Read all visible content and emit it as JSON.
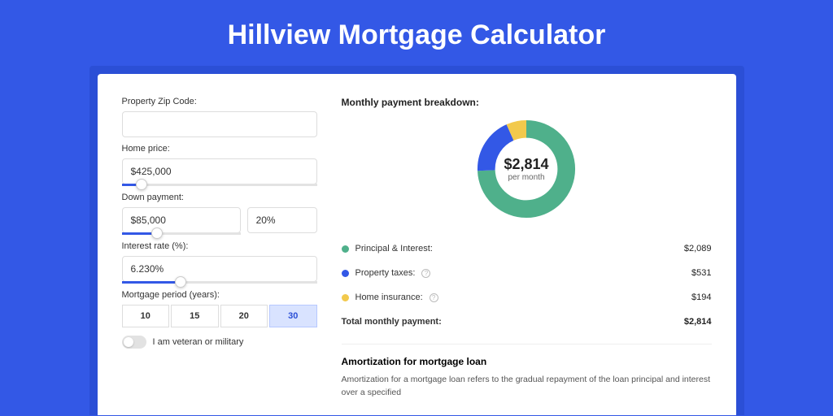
{
  "title": "Hillview Mortgage Calculator",
  "form": {
    "zip_label": "Property Zip Code:",
    "zip_value": "",
    "home_price_label": "Home price:",
    "home_price_value": "$425,000",
    "down_payment_label": "Down payment:",
    "down_payment_value": "$85,000",
    "down_payment_pct": "20%",
    "interest_label": "Interest rate (%):",
    "interest_value": "6.230%",
    "period_label": "Mortgage period (years):",
    "periods": [
      "10",
      "15",
      "20",
      "30"
    ],
    "period_selected": "30",
    "veteran_label": "I am veteran or military"
  },
  "breakdown": {
    "title": "Monthly payment breakdown:",
    "center_value": "$2,814",
    "center_sub": "per month",
    "items": [
      {
        "label": "Principal & Interest:",
        "value": "$2,089",
        "color": "green",
        "info": false
      },
      {
        "label": "Property taxes:",
        "value": "$531",
        "color": "blue",
        "info": true
      },
      {
        "label": "Home insurance:",
        "value": "$194",
        "color": "yellow",
        "info": true
      }
    ],
    "total_label": "Total monthly payment:",
    "total_value": "$2,814"
  },
  "amortization": {
    "title": "Amortization for mortgage loan",
    "text": "Amortization for a mortgage loan refers to the gradual repayment of the loan principal and interest over a specified"
  },
  "chart_data": {
    "type": "pie",
    "title": "Monthly payment breakdown",
    "series": [
      {
        "name": "Principal & Interest",
        "value": 2089,
        "color": "#4fb08b"
      },
      {
        "name": "Property taxes",
        "value": 531,
        "color": "#3358e6"
      },
      {
        "name": "Home insurance",
        "value": 194,
        "color": "#f2c94c"
      }
    ],
    "total": 2814,
    "center_label": "$2,814 per month"
  }
}
